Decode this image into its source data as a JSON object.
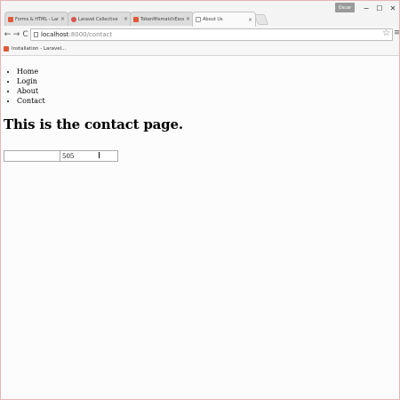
{
  "browser": {
    "tabs": [
      {
        "title": "Forms & HTML - Laravel",
        "icon": "laravel-icon",
        "active": false
      },
      {
        "title": "Laravel Collective",
        "icon": "collective-icon",
        "active": false
      },
      {
        "title": "TokenMismatchException",
        "icon": "laravel-icon",
        "active": false
      },
      {
        "title": "About Us",
        "icon": "page-icon",
        "active": true
      }
    ],
    "tab_close": "×",
    "profile": "Oscar",
    "window_controls": {
      "minimize": "−",
      "maximize": "☐",
      "close": "✕"
    },
    "nav": {
      "back": "←",
      "forward": "→",
      "reload": "C"
    },
    "address": {
      "host": "localhost",
      "path": ":8000/contact"
    },
    "star": "☆",
    "menu": "≡",
    "bookmarks": [
      {
        "label": "Installation - Laravel..."
      }
    ]
  },
  "page": {
    "nav_items": [
      "Home",
      "Login",
      "About",
      "Contact"
    ],
    "heading": "This is the contact page.",
    "inputs": [
      {
        "value": ""
      },
      {
        "value": "505"
      }
    ],
    "cursor": "I"
  }
}
